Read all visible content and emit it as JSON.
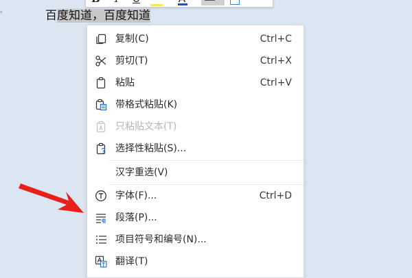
{
  "document": {
    "selected_text": "百度知道，百度知道",
    "selected_prefix": "百",
    "selected_rest": "度知道，百度知道"
  },
  "mini_toolbar": {
    "bold_label": "B",
    "italic_label": "I",
    "underline_label": "U",
    "font_color_label": "A",
    "font_color": "#1d4ad8",
    "highlight_color": "#f6e84b"
  },
  "context_menu": {
    "items": [
      {
        "label": "复制(C)",
        "shortcut": "Ctrl+C",
        "icon": "copy-icon"
      },
      {
        "label": "剪切(T)",
        "shortcut": "Ctrl+X",
        "icon": "scissors-icon"
      },
      {
        "label": "粘贴",
        "shortcut": "Ctrl+V",
        "icon": "paste-icon"
      },
      {
        "label": "带格式粘贴(K)",
        "shortcut": "",
        "icon": "paste-formatted-icon"
      },
      {
        "label": "只粘贴文本(T)",
        "shortcut": "",
        "icon": "paste-text-only-icon",
        "disabled": true
      },
      {
        "label": "选择性粘贴(S)...",
        "shortcut": "",
        "icon": "paste-special-icon"
      },
      {
        "label": "汉字重选(V)",
        "shortcut": "",
        "icon": ""
      },
      {
        "label": "字体(F)...",
        "shortcut": "Ctrl+D",
        "icon": "font-icon"
      },
      {
        "label": "段落(P)...",
        "shortcut": "",
        "icon": "paragraph-icon"
      },
      {
        "label": "项目符号和编号(N)...",
        "shortcut": "",
        "icon": "bullet-list-icon"
      },
      {
        "label": "翻译(T)",
        "shortcut": "",
        "icon": "translate-icon"
      }
    ]
  },
  "annotation": {
    "arrow_color": "#e8201a"
  }
}
